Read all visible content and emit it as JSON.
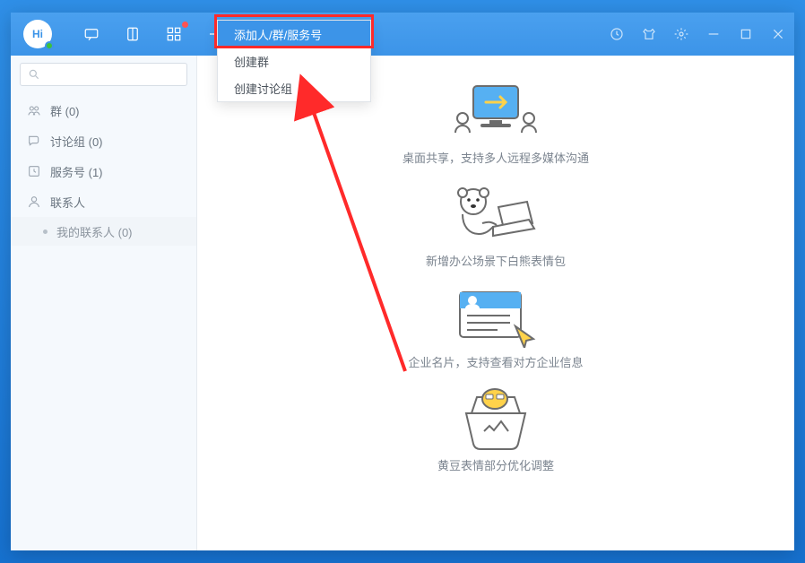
{
  "avatar_text": "Hi",
  "sidebar": {
    "items": [
      {
        "label": "群 (0)"
      },
      {
        "label": "讨论组 (0)"
      },
      {
        "label": "服务号 (1)"
      },
      {
        "label": "联系人"
      }
    ],
    "sub": {
      "label": "我的联系人 (0)"
    }
  },
  "dropdown": {
    "add": "添加人/群/服务号",
    "create_group": "创建群",
    "create_discuss": "创建讨论组"
  },
  "features": [
    "桌面共享，支持多人远程多媒体沟通",
    "新增办公场景下白熊表情包",
    "企业名片，支持查看对方企业信息",
    "黄豆表情部分优化调整"
  ]
}
